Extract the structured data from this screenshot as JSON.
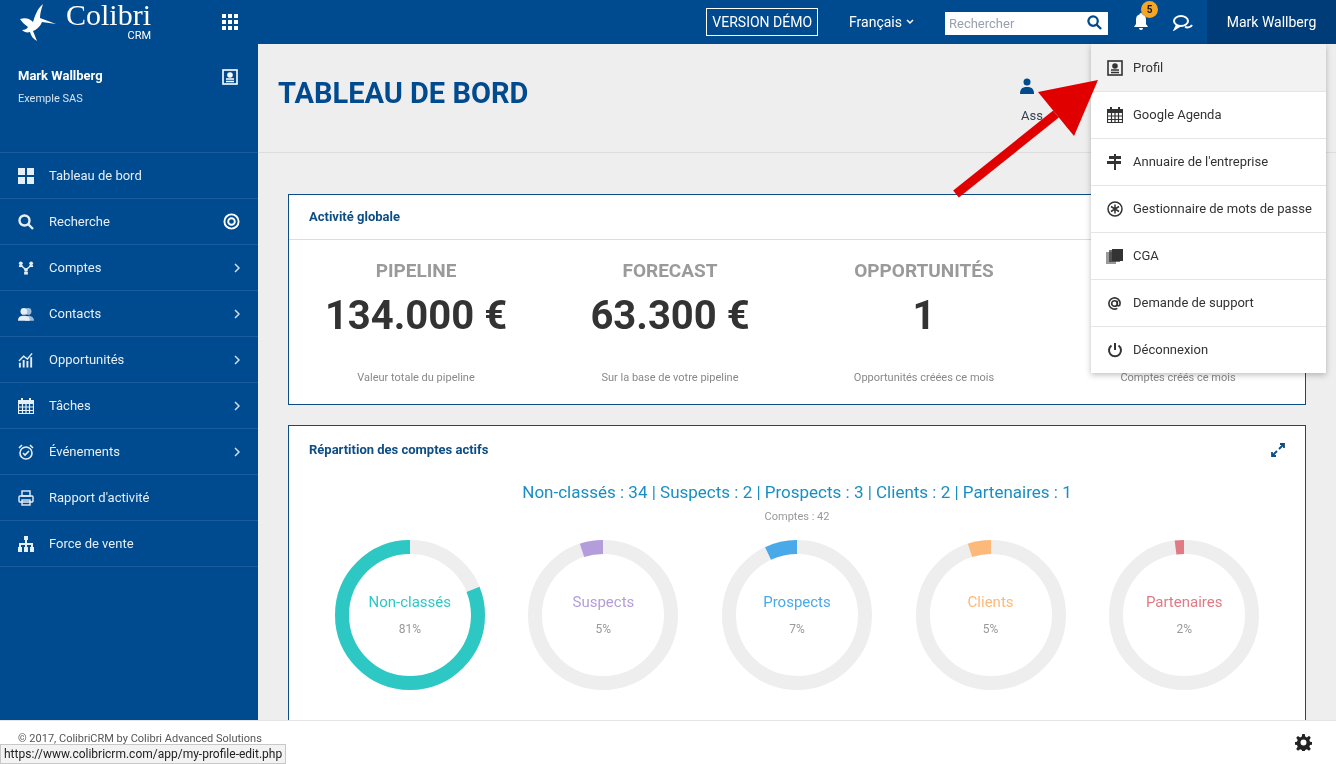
{
  "topbar": {
    "logo": {
      "name": "Colibri",
      "sub": "CRM"
    },
    "demo_label": "VERSION DÉMO",
    "language": "Français",
    "search": {
      "placeholder": "Rechercher"
    },
    "notifications_count": "5",
    "user": "Mark Wallberg"
  },
  "sidebar": {
    "user": {
      "name": "Mark Wallberg",
      "company": "Exemple SAS"
    },
    "items": [
      {
        "label": "Tableau de bord",
        "kind": "plain"
      },
      {
        "label": "Recherche",
        "kind": "target"
      },
      {
        "label": "Comptes",
        "kind": "chevron"
      },
      {
        "label": "Contacts",
        "kind": "chevron"
      },
      {
        "label": "Opportunités",
        "kind": "chevron"
      },
      {
        "label": "Tâches",
        "kind": "chevron"
      },
      {
        "label": "Événements",
        "kind": "chevron"
      },
      {
        "label": "Rapport d'activité",
        "kind": "plain"
      },
      {
        "label": "Force de vente",
        "kind": "plain"
      }
    ]
  },
  "page": {
    "title": "TABLEAU DE BORD",
    "header_action": "Ass"
  },
  "activity": {
    "title": "Activité globale",
    "kpis": [
      {
        "title": "PIPELINE",
        "value": "134.000 €",
        "caption": "Valeur totale du pipeline"
      },
      {
        "title": "FORECAST",
        "value": "63.300 €",
        "caption": "Sur la base de votre pipeline"
      },
      {
        "title": "OPPORTUNITÉS",
        "value": "1",
        "caption": "Opportunités créées ce mois"
      },
      {
        "caption": "Comptes créés ce mois"
      }
    ]
  },
  "distribution": {
    "title": "Répartition des comptes actifs",
    "summary": "Non-classés : 34 | Suspects : 2 | Prospects : 3 | Clients : 2 | Partenaires : 1",
    "total": "Comptes : 42",
    "donuts": [
      {
        "label": "Non-classés",
        "percent": "81%",
        "level": 0.81,
        "color": "#2ec8c4"
      },
      {
        "label": "Suspects",
        "percent": "5%",
        "level": 0.05,
        "color": "#b39ddb"
      },
      {
        "label": "Prospects",
        "percent": "7%",
        "level": 0.07,
        "color": "#4aa9e9"
      },
      {
        "label": "Clients",
        "percent": "5%",
        "level": 0.05,
        "color": "#fdb97a"
      },
      {
        "label": "Partenaires",
        "percent": "2%",
        "level": 0.02,
        "color": "#e07a85"
      }
    ]
  },
  "user_menu": {
    "items": [
      {
        "label": "Profil",
        "selected": true
      },
      {
        "label": "Google Agenda",
        "selected": false
      },
      {
        "label": "Annuaire de l'entreprise",
        "selected": false
      },
      {
        "label": "Gestionnaire de mots de passe",
        "selected": false
      },
      {
        "label": "CGA",
        "selected": false
      },
      {
        "label": "Demande de support",
        "selected": false
      },
      {
        "label": "Déconnexion",
        "selected": false
      }
    ]
  },
  "footer": {
    "copyright": "© 2017, ColibriCRM by Colibri Advanced Solutions"
  },
  "status_url": "https://www.colibricrm.com/app/my-profile-edit.php"
}
